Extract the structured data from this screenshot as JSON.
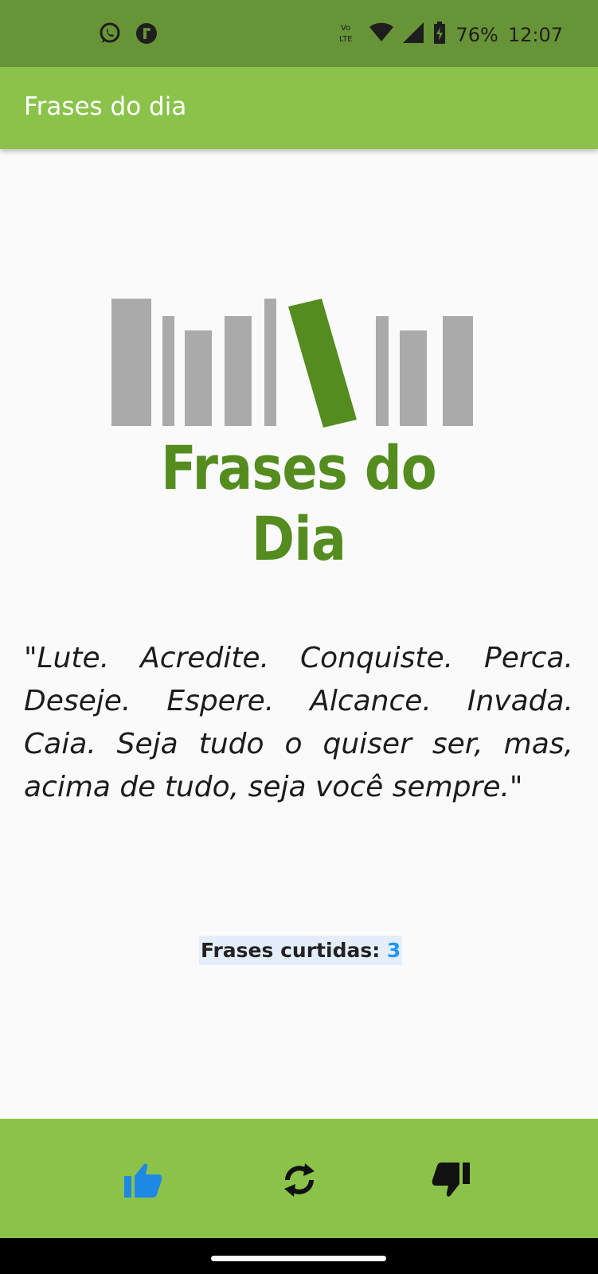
{
  "status_bar": {
    "battery_text": "76%",
    "time": "12:07",
    "network_label": "Vo LTE",
    "icons": [
      "whatsapp-icon",
      "app-notification-icon",
      "volte-icon",
      "wifi-icon",
      "signal-icon",
      "battery-icon"
    ]
  },
  "app_bar": {
    "title": "Frases do dia"
  },
  "logo": {
    "text": "Frases do Dia",
    "book_color": "#aaaaaa",
    "accent_color": "#548c1f"
  },
  "quote": {
    "text": "\"Lute. Acredite. Conquiste. Perca. Deseje. Espere. Alcance. Invada. Caia. Seja tudo o quiser ser, mas, acima de tudo, seja você sempre.\""
  },
  "counter": {
    "label": "Frases curtidas: ",
    "value": "3"
  },
  "bottom_bar": {
    "like_icon": "thumb-up-icon",
    "refresh_icon": "refresh-icon",
    "dislike_icon": "thumb-down-icon",
    "like_color": "#1e88e5"
  },
  "colors": {
    "primary": "#8bc34a",
    "status_bar": "#689438",
    "accent": "#2196f3"
  }
}
